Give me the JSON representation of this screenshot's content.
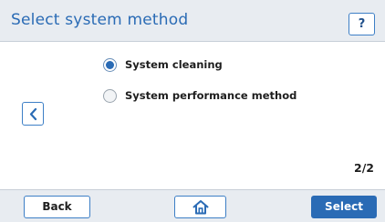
{
  "header": {
    "title": "Select system  method",
    "help_label": "?"
  },
  "options": [
    {
      "label": "System cleaning",
      "selected": true
    },
    {
      "label": "System performance method",
      "selected": false
    }
  ],
  "pagination": {
    "indicator": "2/2"
  },
  "footer": {
    "back_label": "Back",
    "select_label": "Select"
  },
  "icons": {
    "help": "question-mark",
    "previous": "chevron-left-icon",
    "home": "home-icon"
  },
  "colors": {
    "accent": "#2a6bb5",
    "bar_background": "#e8ecf1"
  }
}
